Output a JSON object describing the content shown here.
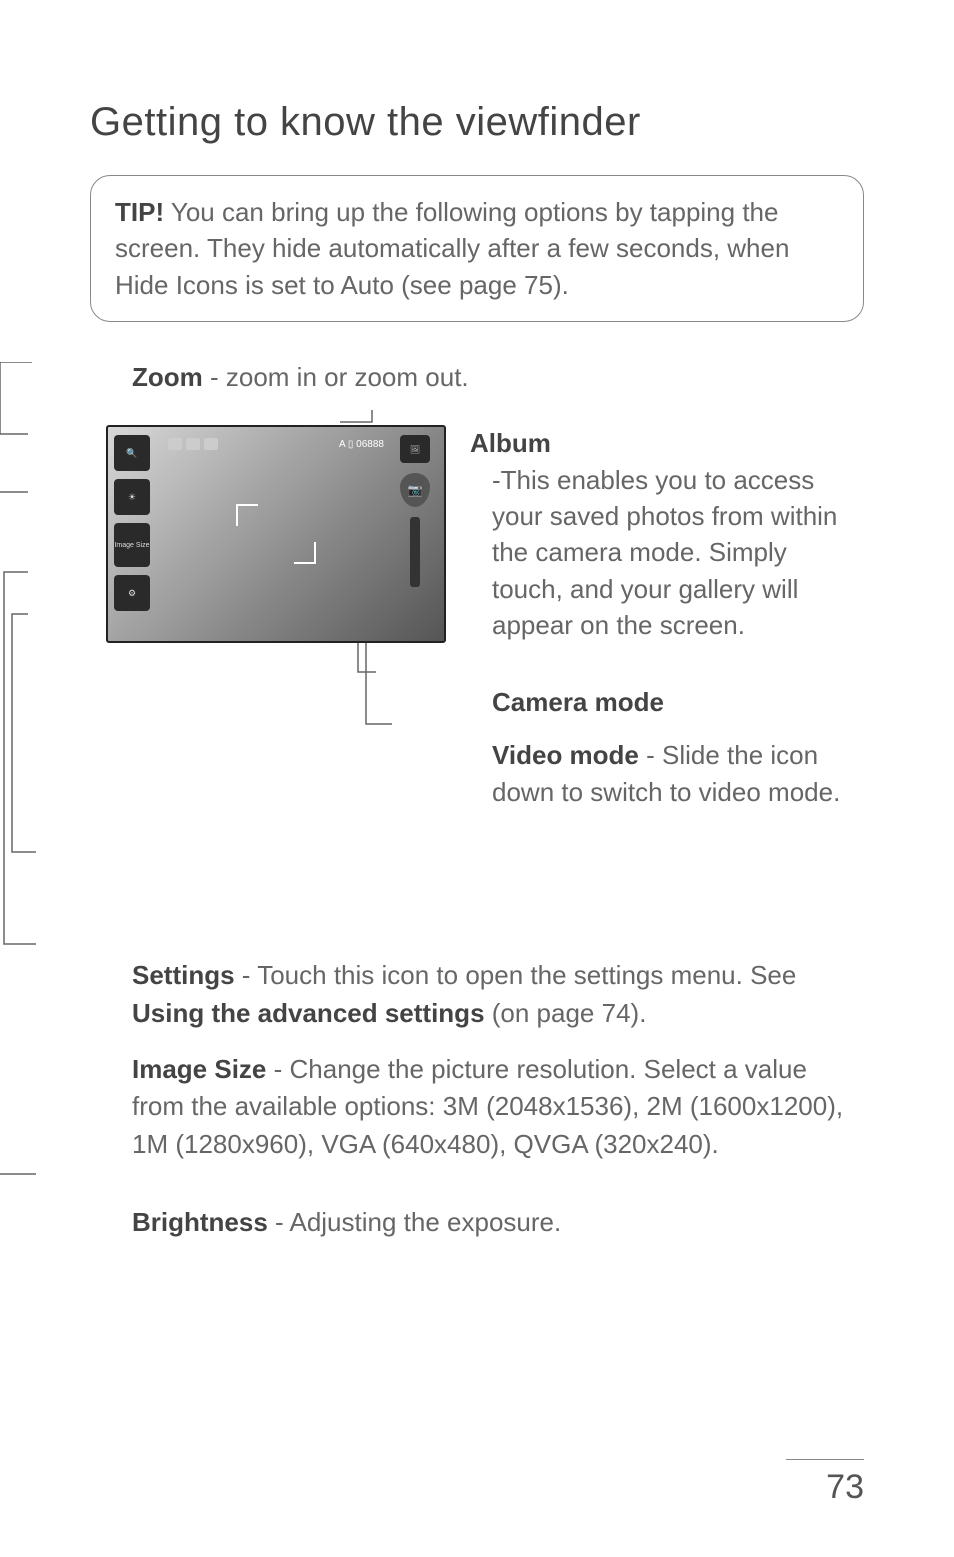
{
  "title": "Getting to know the viewfinder",
  "tip": {
    "label": "TIP!",
    "text": " You can bring up the following options by tapping the screen. They hide automatically after a few seconds, when Hide Icons is set to Auto (see page 75)."
  },
  "zoom": {
    "label": "Zoom",
    "desc": " - zoom in or zoom out."
  },
  "viewfinder": {
    "top_counter": "A ▯ 06888",
    "left_icons": {
      "zoom": "Zoom",
      "brightness": "Bright-ness",
      "size": "Image Size",
      "settings": "Settings"
    },
    "right_icons": {
      "album": "Album"
    }
  },
  "album": {
    "label": "Album",
    "desc": " -This enables you to access your saved photos from within the camera mode. Simply touch, and your gallery will appear on the screen."
  },
  "camera_mode": {
    "label": "Camera mode"
  },
  "video_mode": {
    "label": "Video mode",
    "desc": " - Slide the icon down to switch to video mode."
  },
  "settings": {
    "label": "Settings",
    "desc_pre": " - Touch this icon to open the settings menu. See ",
    "link": "Using the advanced settings",
    "desc_post": " (on page 74)."
  },
  "image_size": {
    "label": "Image Size",
    "desc": " - Change the picture resolution. Select a value from the available options: 3M (2048x1536), 2M (1600x1200), 1M (1280x960), VGA (640x480), QVGA (320x240)."
  },
  "brightness": {
    "label": "Brightness",
    "desc": " - Adjusting the exposure."
  },
  "page_number": "73"
}
